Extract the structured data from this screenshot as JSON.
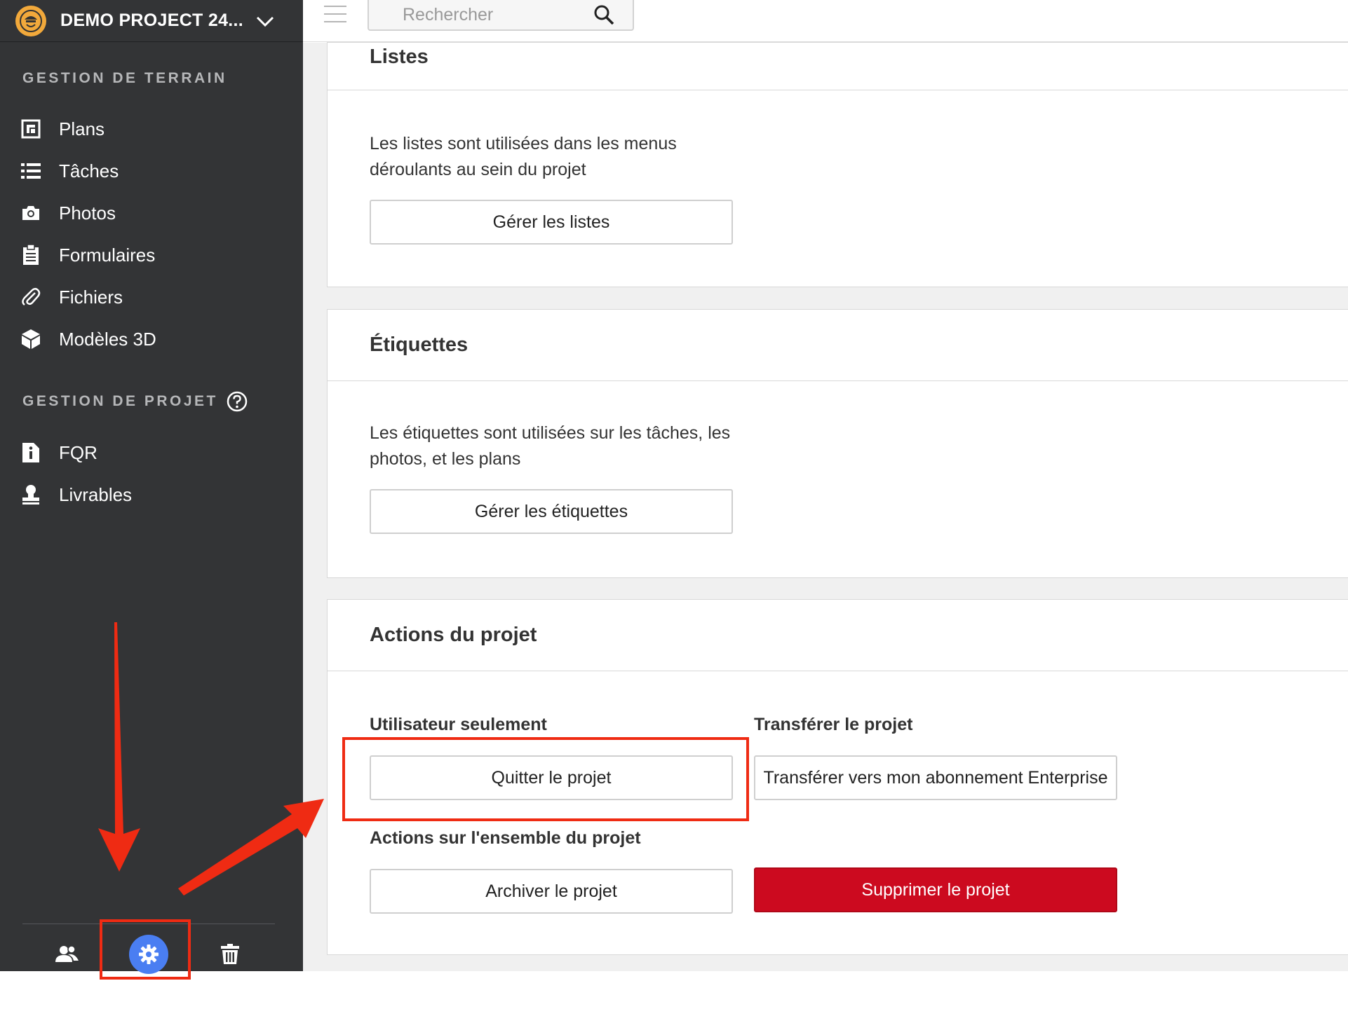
{
  "sidebar": {
    "project_name": "DEMO PROJECT 24...",
    "section_terrain": "GESTION DE TERRAIN",
    "terrain_items": [
      {
        "label": "Plans",
        "icon": "plans-icon"
      },
      {
        "label": "Tâches",
        "icon": "list-icon"
      },
      {
        "label": "Photos",
        "icon": "camera-icon"
      },
      {
        "label": "Formulaires",
        "icon": "clipboard-icon"
      },
      {
        "label": "Fichiers",
        "icon": "paperclip-icon"
      },
      {
        "label": "Modèles 3D",
        "icon": "cube-icon"
      }
    ],
    "section_projet": "GESTION DE PROJET",
    "projet_items": [
      {
        "label": "FQR",
        "icon": "info-document-icon"
      },
      {
        "label": "Livrables",
        "icon": "stamp-icon"
      }
    ],
    "bottom_icons": [
      "users-icon",
      "gear-icon",
      "trash-icon"
    ]
  },
  "topbar": {
    "search_placeholder": "Rechercher"
  },
  "listes": {
    "title": "Listes",
    "description": "Les listes sont utilisées dans les menus déroulants au sein du projet",
    "button": "Gérer les listes"
  },
  "etiquettes": {
    "title": "Étiquettes",
    "description": "Les étiquettes sont utilisées sur les tâches, les photos, et les plans",
    "button": "Gérer les étiquettes"
  },
  "actions": {
    "title": "Actions du projet",
    "user_only_label": "Utilisateur seulement",
    "quit_button": "Quitter le projet",
    "transfer_label": "Transférer le projet",
    "transfer_button": "Transférer vers mon abonnement Enterprise",
    "project_actions_label": "Actions sur l'ensemble du projet",
    "archive_button": "Archiver le projet",
    "delete_button": "Supprimer le projet"
  },
  "colors": {
    "sidebar_bg": "#333436",
    "accent_blue": "#4a7ef2",
    "danger_red": "#cc0a1f",
    "annotation_red": "#ef2b13",
    "logo_orange": "#f2a93b"
  }
}
